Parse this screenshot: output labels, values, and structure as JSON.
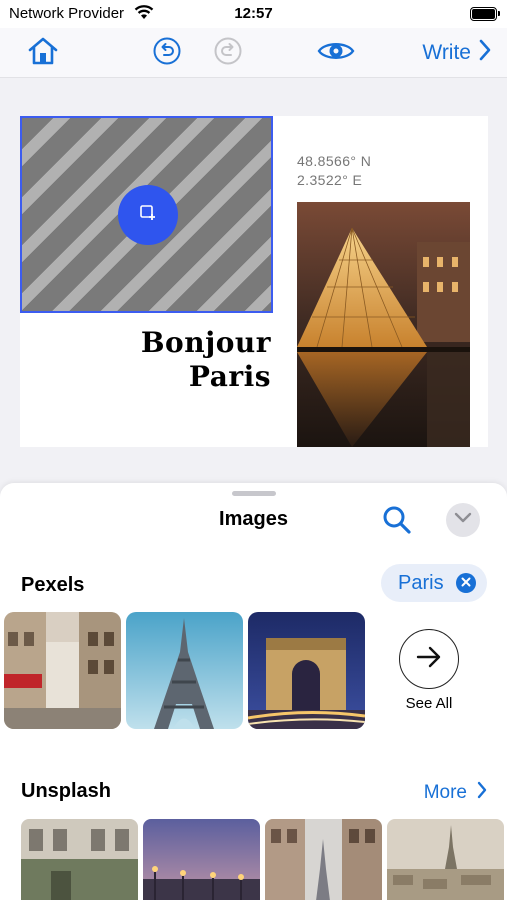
{
  "status_bar": {
    "carrier": "Network Provider",
    "time": "12:57"
  },
  "toolbar": {
    "home_icon": "home-icon",
    "undo_icon": "undo-icon",
    "redo_icon": "redo-icon",
    "preview_icon": "eye-icon",
    "write_label": "Write",
    "accent": "#1870d6"
  },
  "canvas": {
    "title_line1": "Bonjour",
    "title_line2": "Paris",
    "coord_lat": "48.8566° N",
    "coord_lon": "2.3522° E",
    "placeholder_accent": "#2f55ee"
  },
  "sheet": {
    "title": "Images",
    "pexels": {
      "title": "Pexels",
      "query": "Paris",
      "see_all": "See All",
      "thumbnails": [
        "paris-street-photo",
        "eiffel-tower-photo",
        "arc-de-triomphe-photo"
      ]
    },
    "unsplash": {
      "title": "Unsplash",
      "more": "More",
      "thumbnails": [
        "paris-building-photo",
        "bridge-dusk-photo",
        "paris-street-eiffel-photo",
        "paris-skyline-photo"
      ]
    }
  }
}
